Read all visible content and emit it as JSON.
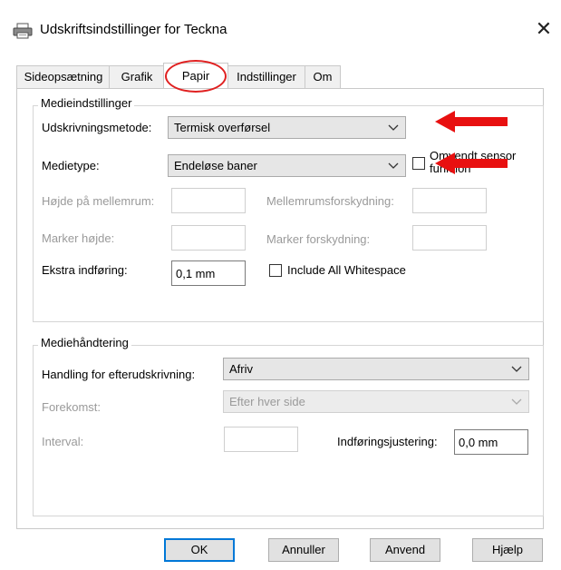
{
  "window": {
    "title": "Udskriftsindstillinger for Teckna",
    "close": "✕"
  },
  "tabs": [
    {
      "label": "Sideopsætning"
    },
    {
      "label": "Grafik"
    },
    {
      "label": "Papir"
    },
    {
      "label": "Indstillinger"
    },
    {
      "label": "Om"
    }
  ],
  "active_tab": "Papir",
  "media_settings": {
    "group_label": "Medieindstillinger",
    "print_method_label": "Udskrivningsmetode:",
    "print_method_value": "Termisk overførsel",
    "media_type_label": "Medietype:",
    "media_type_value": "Endeløse baner",
    "inverted_sensor_label_1": "Omvendt sensor",
    "inverted_sensor_label_2": "funktion",
    "gap_height_label": "Højde på mellemrum:",
    "gap_offset_label": "Mellemrumsforskydning:",
    "mark_height_label": "Marker højde:",
    "mark_offset_label": "Marker forskydning:",
    "extra_feed_label": "Ekstra indføring:",
    "extra_feed_value": "0,1 mm",
    "include_whitespace_label": "Include All Whitespace"
  },
  "media_handling": {
    "group_label": "Mediehåndtering",
    "post_print_label": "Handling for efterudskrivning:",
    "post_print_value": "Afriv",
    "occurrence_label": "Forekomst:",
    "occurrence_value": "Efter hver side",
    "interval_label": "Interval:",
    "feed_adjust_label": "Indføringsjustering:",
    "feed_adjust_value": "0,0 mm"
  },
  "buttons": {
    "ok": "OK",
    "cancel": "Annuller",
    "apply": "Anvend",
    "help": "Hjælp"
  },
  "colors": {
    "annotation": "#e02020",
    "accent": "#0078d7"
  }
}
